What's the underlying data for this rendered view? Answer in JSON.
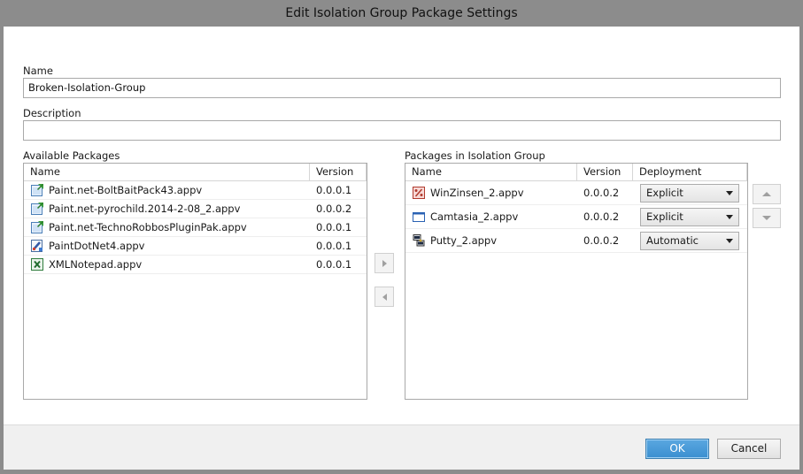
{
  "window": {
    "title": "Edit Isolation Group Package Settings"
  },
  "form": {
    "name_label": "Name",
    "name_value": "Broken-Isolation-Group",
    "description_label": "Description",
    "description_value": ""
  },
  "available": {
    "label": "Available Packages",
    "columns": {
      "name": "Name",
      "version": "Version"
    },
    "rows": [
      {
        "name": "Paint.net-BoltBaitPack43.appv",
        "version": "0.0.0.1",
        "icon": "appv-package-icon"
      },
      {
        "name": "Paint.net-pyrochild.2014-2-08_2.appv",
        "version": "0.0.0.2",
        "icon": "appv-package-icon"
      },
      {
        "name": "Paint.net-TechnoRobbosPluginPak.appv",
        "version": "0.0.0.1",
        "icon": "appv-package-icon"
      },
      {
        "name": "PaintDotNet4.appv",
        "version": "0.0.0.1",
        "icon": "paint-app-icon"
      },
      {
        "name": "XMLNotepad.appv",
        "version": "0.0.0.1",
        "icon": "excel-style-icon"
      }
    ]
  },
  "group": {
    "label": "Packages in Isolation Group",
    "columns": {
      "name": "Name",
      "version": "Version",
      "deployment": "Deployment"
    },
    "rows": [
      {
        "name": "WinZinsen_2.appv",
        "version": "0.0.0.2",
        "deployment": "Explicit",
        "icon": "percent-app-icon"
      },
      {
        "name": "Camtasia_2.appv",
        "version": "0.0.0.2",
        "deployment": "Explicit",
        "icon": "window-app-icon"
      },
      {
        "name": "Putty_2.appv",
        "version": "0.0.0.2",
        "deployment": "Automatic",
        "icon": "putty-app-icon"
      }
    ]
  },
  "buttons": {
    "ok": "OK",
    "cancel": "Cancel"
  }
}
